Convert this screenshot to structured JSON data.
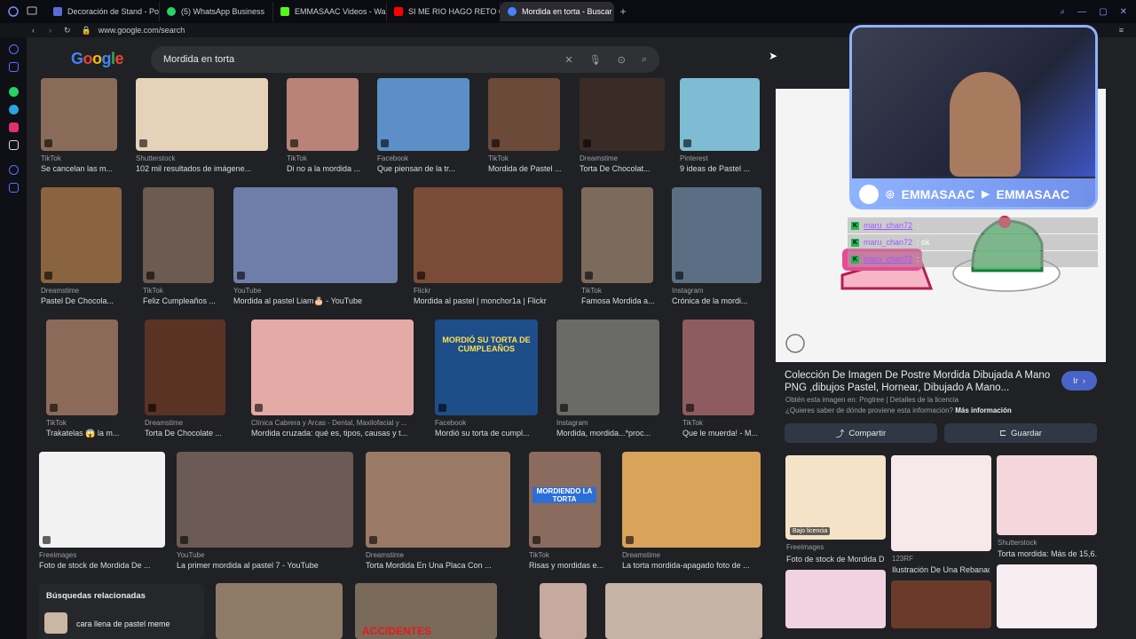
{
  "browser": {
    "tabs": [
      {
        "label": "Decoración de Stand - Po",
        "color": "#5a6cd8"
      },
      {
        "label": "(5) WhatsApp Business",
        "color": "#25d366"
      },
      {
        "label": "EMMASAAC Videos - Wa",
        "color": "#53fc18"
      },
      {
        "label": "SI ME RIO HAGO RETO C",
        "color": "#ff0000"
      },
      {
        "label": "Mordida en torta - Buscar",
        "color": "#4285f4",
        "active": true
      }
    ],
    "new_tab": "+",
    "url": "www.google.com/search"
  },
  "google": {
    "logo": "Google",
    "query": "Mordida en torta"
  },
  "results": [
    {
      "source": "TikTok",
      "caption": "Se cancelan las m...",
      "color": "#8a6b5a"
    },
    {
      "source": "Shutterstock",
      "caption": "102 mil resultados de imágene...",
      "color": "#e6d2b8"
    },
    {
      "source": "TikTok",
      "caption": "Di no a la mordida ...",
      "color": "#b98378"
    },
    {
      "source": "Facebook",
      "caption": "Que piensan de la tr...",
      "color": "#5c8fc7"
    },
    {
      "source": "TikTok",
      "caption": "Mordida de Pastel ...",
      "color": "#6b4a3a"
    },
    {
      "source": "Dreamstime",
      "caption": "Torta De Chocolat...",
      "color": "#3a2b26"
    },
    {
      "source": "Pinterest",
      "caption": "9 ideas de Pastel ...",
      "color": "#7dbcd3"
    },
    {
      "source": "Dreamstime",
      "caption": "Pastel De Chocola...",
      "color": "#8a6440"
    },
    {
      "source": "TikTok",
      "caption": "Feliz Cumpleaños ...",
      "color": "#6d5a50"
    },
    {
      "source": "YouTube",
      "caption": "Mordida al pastel Liam🎂 - YouTube",
      "color": "#6f7ea8"
    },
    {
      "source": "Flickr",
      "caption": "Mordida al pastel | monchor1a | Flickr",
      "color": "#7a4b37"
    },
    {
      "source": "TikTok",
      "caption": "Famosa Mordida a...",
      "color": "#7c6a5c"
    },
    {
      "source": "Instagram",
      "caption": "Crónica de la mordi...",
      "color": "#5a6f84"
    },
    {
      "source": "TikTok",
      "caption": "Trakatelas 😱 la m...",
      "color": "#8c6a5a"
    },
    {
      "source": "Dreamstime",
      "caption": "Torta De Chocolate ...",
      "color": "#5a3324"
    },
    {
      "source": "Clínica Cabrera y Arcas - Dental, Maxilofacial y ...",
      "caption": "Mordida cruzada: qué es, tipos, causas y t...",
      "color": "#e4aaa6"
    },
    {
      "source": "Facebook",
      "caption": "Mordió su torta de cumpl...",
      "color": "#1d4e8a"
    },
    {
      "source": "Instagram",
      "caption": "Mordida, mordida...*proc...",
      "color": "#6a6a66"
    },
    {
      "source": "TikTok",
      "caption": "Que le muerda! - M...",
      "color": "#8e5b5f"
    },
    {
      "source": "Freeimages",
      "caption": "Foto de stock de Mordida De ...",
      "color": "#f2f2f2"
    },
    {
      "source": "YouTube",
      "caption": "La primer mordida al pastel 7 - YouTube",
      "color": "#6b5a55"
    },
    {
      "source": "Dreamstime",
      "caption": "Torta Mordida En Una Placa Con ...",
      "color": "#9a7a66"
    },
    {
      "source": "TikTok",
      "caption": "Risas y mordidas e...",
      "color": "#8a6b5e"
    },
    {
      "source": "Dreamstime",
      "caption": "La torta mordida-apagado foto de ...",
      "color": "#d9a35a"
    }
  ],
  "overlays": {
    "thumb_text_1": "MORDIÓ SU TORTA DE CUMPLEAÑOS",
    "thumb_text_2": "MORDIENDO LA TORTA",
    "thumb_text_3": "ACCIDENTES"
  },
  "related": {
    "title": "Búsquedas relacionadas",
    "item": "cara llena de pastel meme"
  },
  "panel": {
    "title": "Colección De Imagen De Postre Mordida Dibujada A Mano PNG ,dibujos Pastel, Hornear, Dibujado A Mano...",
    "go_button": "Ir",
    "source_line": "Obtén esta imagen en: Pngtree | Detalles de la licencia",
    "question": "¿Quieres saber de dónde proviene esta información?",
    "more_info": "Más información",
    "share_button": "Compartir",
    "save_button": "Guardar",
    "related": [
      {
        "badge": "Bajo licencia",
        "source": "Freeimages",
        "caption": "Foto de stock de Mordida D...",
        "color": "#f5e3c8"
      },
      {
        "source": "123RF",
        "caption": "Ilustración De Una Rebanad...",
        "color": "#f7e8ea"
      },
      {
        "source": "Shutterstock",
        "caption": "Torta mordida: Más de 15,6...",
        "color": "#f4d6dc"
      }
    ]
  },
  "stream": {
    "channel_1": "EMMASAAC",
    "channel_2": "EMMASAAC",
    "chat": [
      {
        "user": "maru_chan72",
        "msg": ":"
      },
      {
        "user": "maru_chan72",
        "msg": ": ok"
      },
      {
        "user": "maru_chan72",
        "msg": ":"
      }
    ]
  }
}
